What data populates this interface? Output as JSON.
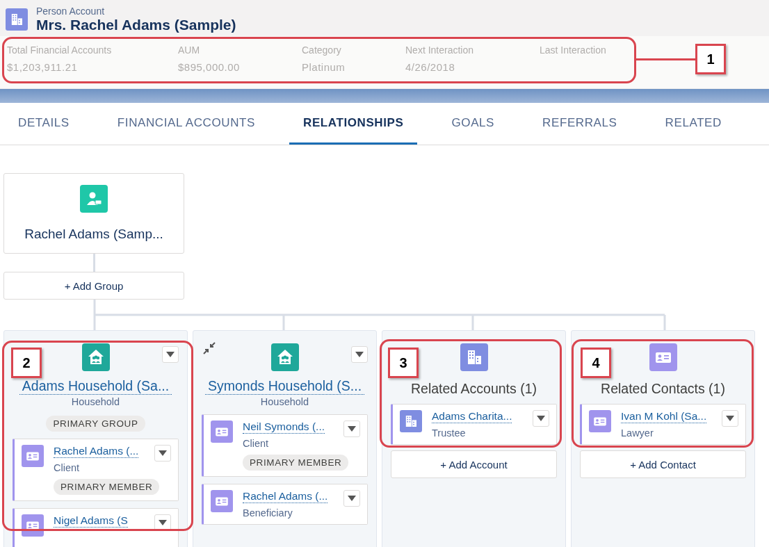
{
  "record": {
    "type_label": "Person Account",
    "title": "Mrs. Rachel Adams (Sample)"
  },
  "highlights": [
    {
      "label": "Total Financial Accounts",
      "value": "$1,203,911.21"
    },
    {
      "label": "AUM",
      "value": "$895,000.00"
    },
    {
      "label": "Category",
      "value": "Platinum"
    },
    {
      "label": "Next Interaction",
      "value": "4/26/2018"
    },
    {
      "label": "Last Interaction"
    }
  ],
  "tabs": [
    {
      "label": "DETAILS",
      "selected": false
    },
    {
      "label": "FINANCIAL ACCOUNTS",
      "selected": false
    },
    {
      "label": "RELATIONSHIPS",
      "selected": true
    },
    {
      "label": "GOALS",
      "selected": false
    },
    {
      "label": "REFERRALS",
      "selected": false
    },
    {
      "label": "RELATED",
      "selected": false
    }
  ],
  "root": {
    "name": "Rachel Adams (Samp...",
    "add_button": "+ Add Group"
  },
  "columns": [
    {
      "kind": "household",
      "title": "Adams Household (Sa...",
      "subtitle": "Household",
      "badge": "PRIMARY GROUP",
      "collapse_toggle": false,
      "members": [
        {
          "kind": "contact",
          "name": "Rachel Adams (...",
          "role": "Client",
          "badge": "PRIMARY MEMBER"
        },
        {
          "kind": "contact",
          "name": "Nigel Adams (S"
        }
      ]
    },
    {
      "kind": "household",
      "title": "Symonds Household (S...",
      "subtitle": "Household",
      "collapse_toggle": true,
      "members": [
        {
          "kind": "contact",
          "name": "Neil Symonds (...",
          "role": "Client",
          "badge": "PRIMARY MEMBER"
        },
        {
          "kind": "contact",
          "name": "Rachel Adams (...",
          "role": "Beneficiary"
        }
      ]
    },
    {
      "kind": "related_accounts",
      "title": "Related Accounts (1)",
      "members": [
        {
          "kind": "account",
          "name": "Adams Charita...",
          "role": "Trustee"
        }
      ],
      "add_button": "+ Add Account"
    },
    {
      "kind": "related_contacts",
      "title": "Related Contacts (1)",
      "members": [
        {
          "kind": "contact",
          "name": "Ivan M Kohl (Sa...",
          "role": "Lawyer"
        }
      ],
      "add_button": "+ Add Contact"
    }
  ],
  "callouts": [
    {
      "label": "1"
    },
    {
      "label": "2"
    },
    {
      "label": "3"
    },
    {
      "label": "4"
    }
  ]
}
